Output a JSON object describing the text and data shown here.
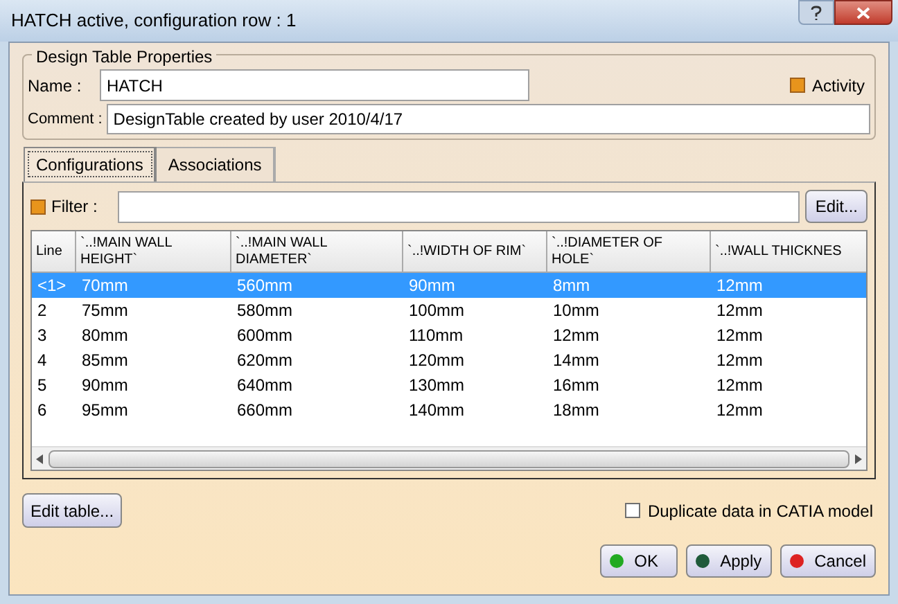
{
  "window": {
    "title": "HATCH active, configuration row : 1"
  },
  "group": {
    "title": "Design Table Properties"
  },
  "name_field": {
    "label": "Name :",
    "value": "HATCH"
  },
  "activity": {
    "label": "Activity",
    "checked": true
  },
  "comment_field": {
    "label": "Comment :",
    "value": "DesignTable created by user 2010/4/17"
  },
  "tabs": [
    {
      "label": "Configurations",
      "selected": true
    },
    {
      "label": "Associations",
      "selected": false
    }
  ],
  "filter": {
    "label": "Filter :",
    "checked": true,
    "button": "Edit..."
  },
  "table": {
    "columns": [
      "Line",
      "`..!MAIN WALL HEIGHT`",
      "`..!MAIN WALL DIAMETER`",
      "`..!WIDTH OF RIM`",
      "`..!DIAMETER OF HOLE`",
      "`..!WALL THICKNES"
    ],
    "rows": [
      {
        "cells": [
          "<1>",
          "70mm",
          "560mm",
          "90mm",
          "8mm",
          "12mm"
        ],
        "selected": true
      },
      {
        "cells": [
          "2",
          "75mm",
          "580mm",
          "100mm",
          "10mm",
          "12mm"
        ],
        "selected": false
      },
      {
        "cells": [
          "3",
          "80mm",
          "600mm",
          "110mm",
          "12mm",
          "12mm"
        ],
        "selected": false
      },
      {
        "cells": [
          "4",
          "85mm",
          "620mm",
          "120mm",
          "14mm",
          "12mm"
        ],
        "selected": false
      },
      {
        "cells": [
          "5",
          "90mm",
          "640mm",
          "130mm",
          "16mm",
          "12mm"
        ],
        "selected": false
      },
      {
        "cells": [
          "6",
          "95mm",
          "660mm",
          "140mm",
          "18mm",
          "12mm"
        ],
        "selected": false
      }
    ]
  },
  "edit_table_button": "Edit table...",
  "duplicate": {
    "label": "Duplicate data in CATIA model",
    "checked": false
  },
  "buttons": [
    {
      "label": "OK",
      "color": "#22aa22"
    },
    {
      "label": "Apply",
      "color": "#1f5a3a"
    },
    {
      "label": "Cancel",
      "color": "#dd2222"
    }
  ]
}
